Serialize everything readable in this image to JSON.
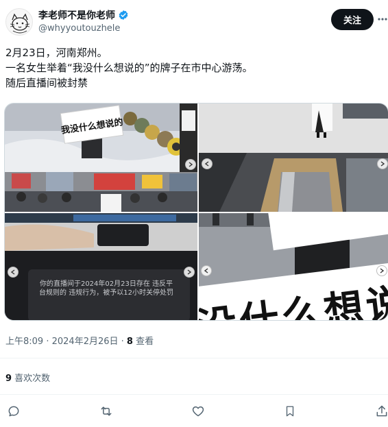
{
  "author": {
    "display_name": "李老师不是你老师",
    "handle": "@whyyoutouzhele",
    "verified_icon": "verified-badge-icon",
    "avatar_icon": "cat-avatar-icon"
  },
  "header": {
    "follow_label": "关注",
    "more_icon": "more-horizontal-icon"
  },
  "tweet": {
    "lines": [
      "2月23日，河南郑州。",
      "一名女生举着“我没什么想说的”的牌子在市中心游荡。",
      "随后直播间被封禁"
    ]
  },
  "media": {
    "sign_text_top": "我没什么想说的",
    "notice_text": "你的直播间于2024年02月23日存在 违反平台规则的 违规行为，被予以12小时关停处罚",
    "big_sign_text": "没什么想说的",
    "colors": {
      "snow": "#e4e6ea",
      "sign": "#ffffff",
      "dark": "#1d1f22",
      "floor": "#8a8f96"
    }
  },
  "meta": {
    "time": "上午8:09",
    "separator": " · ",
    "date": "2024年2月26日",
    "views_count": "8",
    "views_label": " 查看"
  },
  "likes": {
    "count": "9",
    "label": " 喜欢次数"
  },
  "actions": {
    "reply_icon": "reply-icon",
    "retweet_icon": "retweet-icon",
    "like_icon": "heart-icon",
    "bookmark_icon": "bookmark-icon",
    "share_icon": "share-icon"
  },
  "colors": {
    "text": "#0f1419",
    "muted": "#536471",
    "verified": "#1d9bf0",
    "button_bg": "#0f1419"
  }
}
